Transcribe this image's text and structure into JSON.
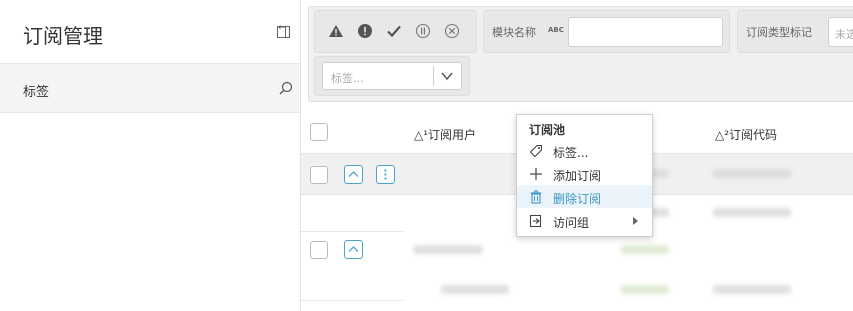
{
  "sidebar": {
    "title": "订阅管理",
    "items": [
      {
        "label": "标签"
      }
    ]
  },
  "toolbar": {
    "severity_icons": [
      "warning-icon",
      "error-icon",
      "check-icon",
      "info-icon",
      "cancel-icon"
    ],
    "module_name_label": "模块名称",
    "abc_badge": "ABC",
    "module_name_value": "",
    "subscription_type_label": "订阅类型标记",
    "subscription_type_value": "未选",
    "tag_placeholder": "标签..."
  },
  "grid": {
    "columns": [
      {
        "label": "△¹订阅用户"
      },
      {
        "label": "△²订阅代码"
      }
    ]
  },
  "context_menu": {
    "title": "订阅池",
    "items": [
      {
        "label": "标签...",
        "icon": "tag-icon"
      },
      {
        "label": "添加订阅",
        "icon": "plus-icon"
      },
      {
        "label": "删除订阅",
        "icon": "trash-icon",
        "active": true
      },
      {
        "label": "访问组",
        "icon": "export-icon",
        "submenu": true
      }
    ]
  },
  "colors": {
    "accent": "#4aa6c9",
    "active_text": "#3a96c4",
    "sidebar_selected": "#f4f4f4"
  }
}
